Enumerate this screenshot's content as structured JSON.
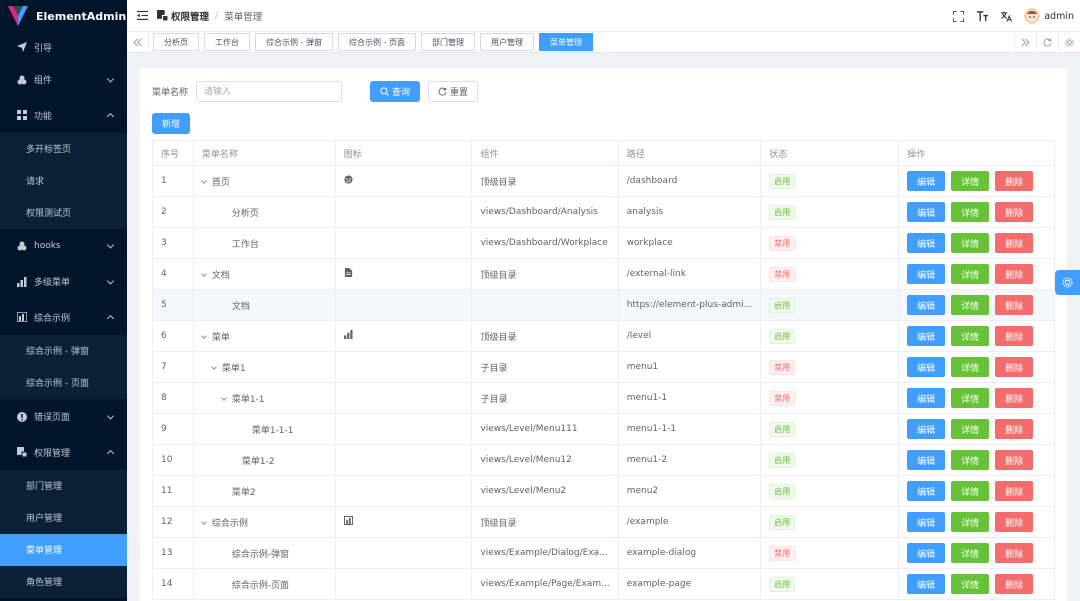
{
  "app": {
    "title": "ElementAdmin"
  },
  "sidebar": {
    "items": [
      {
        "label": "引导",
        "icon": "send-icon"
      },
      {
        "label": "组件",
        "icon": "cube-icon"
      },
      {
        "label": "功能",
        "icon": "grid-icon"
      },
      {
        "label": "多开标签页"
      },
      {
        "label": "请求"
      },
      {
        "label": "权限测试页"
      },
      {
        "label": "hooks",
        "icon": "cube-icon"
      },
      {
        "label": "多级菜单",
        "icon": "bar-chart-icon"
      },
      {
        "label": "综合示例",
        "icon": "chart-icon"
      },
      {
        "label": "综合示例 - 弹窗"
      },
      {
        "label": "综合示例 - 页面"
      },
      {
        "label": "错误页面",
        "icon": "error-icon"
      },
      {
        "label": "权限管理",
        "icon": "lock-icon"
      },
      {
        "label": "部门管理"
      },
      {
        "label": "用户管理"
      },
      {
        "label": "菜单管理"
      },
      {
        "label": "角色管理"
      }
    ]
  },
  "header": {
    "breadcrumb_parent": "权限管理",
    "breadcrumb_sep": "/",
    "breadcrumb_current": "菜单管理",
    "username": "admin"
  },
  "tags": [
    "分析页",
    "工作台",
    "综合示例 - 弹窗",
    "综合示例 - 页面",
    "部门管理",
    "用户管理",
    "菜单管理"
  ],
  "search": {
    "label": "菜单名称",
    "placeholder": "请输入",
    "query_label": "查询",
    "reset_label": "重置",
    "add_label": "新增"
  },
  "table": {
    "headers": [
      "序号",
      "菜单名称",
      "图标",
      "组件",
      "路径",
      "状态",
      "操作"
    ],
    "actions": {
      "edit": "编辑",
      "detail": "详情",
      "delete": "删除"
    },
    "rows": [
      {
        "no": "1",
        "name": "首页",
        "icon": "dashboard-icon",
        "component": "顶级目录",
        "path": "/dashboard",
        "status": "启用"
      },
      {
        "no": "2",
        "name": "分析页",
        "icon": "",
        "component": "views/Dashboard/Analysis",
        "path": "analysis",
        "status": "启用"
      },
      {
        "no": "3",
        "name": "工作台",
        "icon": "",
        "component": "views/Dashboard/Workplace",
        "path": "workplace",
        "status": "禁用"
      },
      {
        "no": "4",
        "name": "文档",
        "icon": "document-icon",
        "component": "顶级目录",
        "path": "/external-link",
        "status": "禁用"
      },
      {
        "no": "5",
        "name": "文档",
        "icon": "",
        "component": "",
        "path": "https://element-plus-admi...",
        "status": "启用"
      },
      {
        "no": "6",
        "name": "菜单",
        "icon": "bar-chart-icon",
        "component": "顶级目录",
        "path": "/level",
        "status": "启用"
      },
      {
        "no": "7",
        "name": "菜单1",
        "icon": "",
        "component": "子目录",
        "path": "menu1",
        "status": "禁用"
      },
      {
        "no": "8",
        "name": "菜单1-1",
        "icon": "",
        "component": "子目录",
        "path": "menu1-1",
        "status": "禁用"
      },
      {
        "no": "9",
        "name": "菜单1-1-1",
        "icon": "",
        "component": "views/Level/Menu111",
        "path": "menu1-1-1",
        "status": "启用"
      },
      {
        "no": "10",
        "name": "菜单1-2",
        "icon": "",
        "component": "views/Level/Menu12",
        "path": "menu1-2",
        "status": "启用"
      },
      {
        "no": "11",
        "name": "菜单2",
        "icon": "",
        "component": "views/Level/Menu2",
        "path": "menu2",
        "status": "启用"
      },
      {
        "no": "12",
        "name": "综合示例",
        "icon": "chart-icon",
        "component": "顶级目录",
        "path": "/example",
        "status": "启用"
      },
      {
        "no": "13",
        "name": "综合示例-弹窗",
        "icon": "",
        "component": "views/Example/Dialog/Exa...",
        "path": "example-dialog",
        "status": "禁用"
      },
      {
        "no": "14",
        "name": "综合示例-页面",
        "icon": "",
        "component": "views/Example/Page/Exam...",
        "path": "example-page",
        "status": "启用"
      }
    ]
  },
  "colors": {
    "primary": "#409eff",
    "success": "#67c23a",
    "danger": "#f56c6c",
    "sidebar": "#001529"
  }
}
